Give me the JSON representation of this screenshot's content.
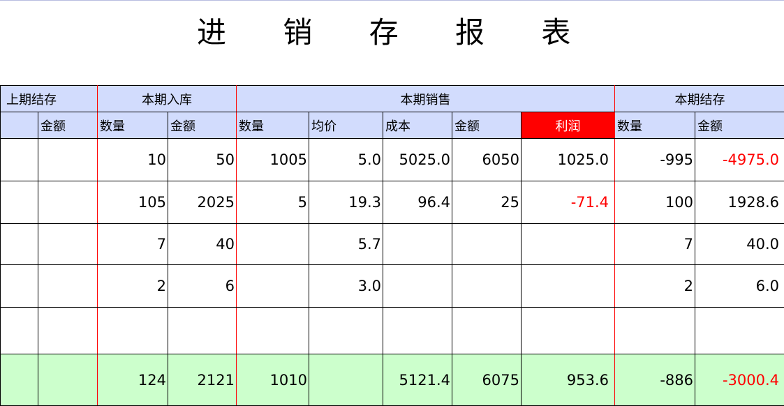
{
  "title": "进 销 存 报 表",
  "headers": {
    "prev_stock": "上期结存",
    "in_stock": "本期入库",
    "sales": "本期销售",
    "end_stock": "本期结存",
    "qty": "数量",
    "amount": "金额",
    "avg_price": "均价",
    "cost": "成本",
    "profit": "利润"
  },
  "rows": [
    {
      "in_qty": "10",
      "in_amt": "50",
      "s_qty": "1005",
      "s_avg": "5.0",
      "s_cost": "5025.0",
      "s_amt": "6050",
      "s_profit": "1025.0",
      "e_qty": "-995",
      "e_amt": "-4975.0"
    },
    {
      "in_qty": "105",
      "in_amt": "2025",
      "s_qty": "5",
      "s_avg": "19.3",
      "s_cost": "96.4",
      "s_amt": "25",
      "s_profit": "-71.4",
      "e_qty": "100",
      "e_amt": "1928.6"
    },
    {
      "in_qty": "7",
      "in_amt": "40",
      "s_qty": "",
      "s_avg": "5.7",
      "s_cost": "",
      "s_amt": "",
      "s_profit": "",
      "e_qty": "7",
      "e_amt": "40.0"
    },
    {
      "in_qty": "2",
      "in_amt": "6",
      "s_qty": "",
      "s_avg": "3.0",
      "s_cost": "",
      "s_amt": "",
      "s_profit": "",
      "e_qty": "2",
      "e_amt": "6.0"
    },
    {
      "in_qty": "",
      "in_amt": "",
      "s_qty": "",
      "s_avg": "",
      "s_cost": "",
      "s_amt": "",
      "s_profit": "",
      "e_qty": "",
      "e_amt": ""
    }
  ],
  "total": {
    "in_qty": "124",
    "in_amt": "2121",
    "s_qty": "1010",
    "s_avg": "",
    "s_cost": "5121.4",
    "s_amt": "6075",
    "s_profit": "953.6",
    "e_qty": "-886",
    "e_amt": "-3000.4"
  },
  "colors": {
    "header_bg": "#d2dcfd",
    "profit_header_bg": "#ff0000",
    "total_bg": "#ccffcc",
    "negative": "#ff0000",
    "section_divider": "#ff0000"
  }
}
